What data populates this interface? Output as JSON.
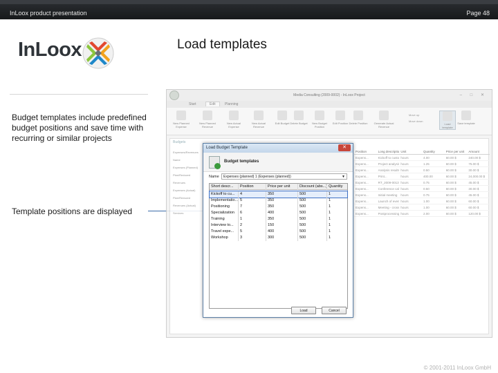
{
  "header": {
    "left_text": "InLoox product presentation",
    "right_text": "Page 48"
  },
  "logo": {
    "text": "InLoox"
  },
  "slide": {
    "title": "Load templates",
    "bullet_1": "Budget templates include predefined budget positions and save time with recurring or similar projects",
    "bullet_2": "Template positions are displayed"
  },
  "footer": {
    "copyright": "© 2001-2011 InLoox GmbH"
  },
  "app_window": {
    "title": "Media Consulting (2009-0002) - InLoox Project",
    "tabs": [
      "Start",
      "Edit",
      "Planning"
    ],
    "ribbon_buttons": [
      "New Planned Expense",
      "New Planned Revenue",
      "New Actual Expense",
      "New Actual Revenue",
      "Edit Budget",
      "Delete Budget",
      "New Budget Position",
      "Edit Position",
      "Delete Position",
      "Generate Actual Revenue",
      "Load template",
      "Save template"
    ],
    "ribbon_side": [
      "Move up",
      "Move down"
    ],
    "section_label": "Budgets",
    "left_pane_items": [
      "Expenses/Revenues",
      "Name",
      "Expenses (Planned)",
      "Plan/Reduced",
      "Revenues",
      "Expenses (Actual)",
      "Plan/Reduced",
      "Revenues (Actual)",
      "Services"
    ],
    "right_columns": [
      "Position",
      "Long description",
      "Unit",
      "Quantity",
      "Price per unit",
      "Amount"
    ],
    "right_rows": [
      [
        "Expens...",
        "Kickoff to custo...",
        "hours",
        "4.00",
        "60.00 $",
        "240.00 $"
      ],
      [
        "Expens...",
        "Project analysis...",
        "hours",
        "1.25",
        "60.00 $",
        "75.00 $"
      ],
      [
        "Expens...",
        "Analysis results",
        "hours",
        "0.50",
        "60.00 $",
        "30.00 $"
      ],
      [
        "Expens...",
        "Print...",
        "hours",
        "400.00",
        "60.00 $",
        "24,000.00 $"
      ],
      [
        "Expens...",
        "RT_2009-0013...",
        "hours",
        "0.75",
        "60.00 $",
        "45.00 $"
      ],
      [
        "Expens...",
        "Conference call...",
        "hours",
        "0.50",
        "60.00 $",
        "30.00 $"
      ],
      [
        "Expens...",
        "Initial meeting",
        "hours",
        "0.75",
        "60.00 $",
        "45.00 $"
      ],
      [
        "Expens...",
        "Launch of event...",
        "hours",
        "1.00",
        "60.00 $",
        "60.00 $"
      ],
      [
        "Expens...",
        "Meeting - cross...",
        "hours",
        "1.00",
        "60.00 $",
        "60.00 $"
      ],
      [
        "Expens...",
        "Postprocessing...",
        "hours",
        "2.00",
        "60.00 $",
        "120.00 $"
      ]
    ]
  },
  "dialog": {
    "title": "Load Budget Template",
    "close_symbol": "✕",
    "heading": "Budget templates",
    "name_label": "Name",
    "name_value": "Expenses (planned) 1 (Expenses (planned))",
    "columns": [
      "Short descr...",
      "Position",
      "Price per unit",
      "Discount (abs...)",
      "Quantity"
    ],
    "rows": [
      [
        "Kickoff to cu...",
        "4",
        "350",
        "500",
        "1"
      ],
      [
        "Implementatio...",
        "5",
        "350",
        "500",
        "1"
      ],
      [
        "Positioning",
        "7",
        "350",
        "500",
        "1"
      ],
      [
        "Specialization",
        "6",
        "400",
        "500",
        "1"
      ],
      [
        "Training",
        "1",
        "350",
        "500",
        "1"
      ],
      [
        "Interview to...",
        "2",
        "150",
        "500",
        "1"
      ],
      [
        "Travel expe...",
        "5",
        "400",
        "500",
        "1"
      ],
      [
        "Workshop",
        "3",
        "300",
        "500",
        "1"
      ]
    ],
    "selected_row": 0,
    "ok_label": "Load",
    "cancel_label": "Cancel"
  }
}
